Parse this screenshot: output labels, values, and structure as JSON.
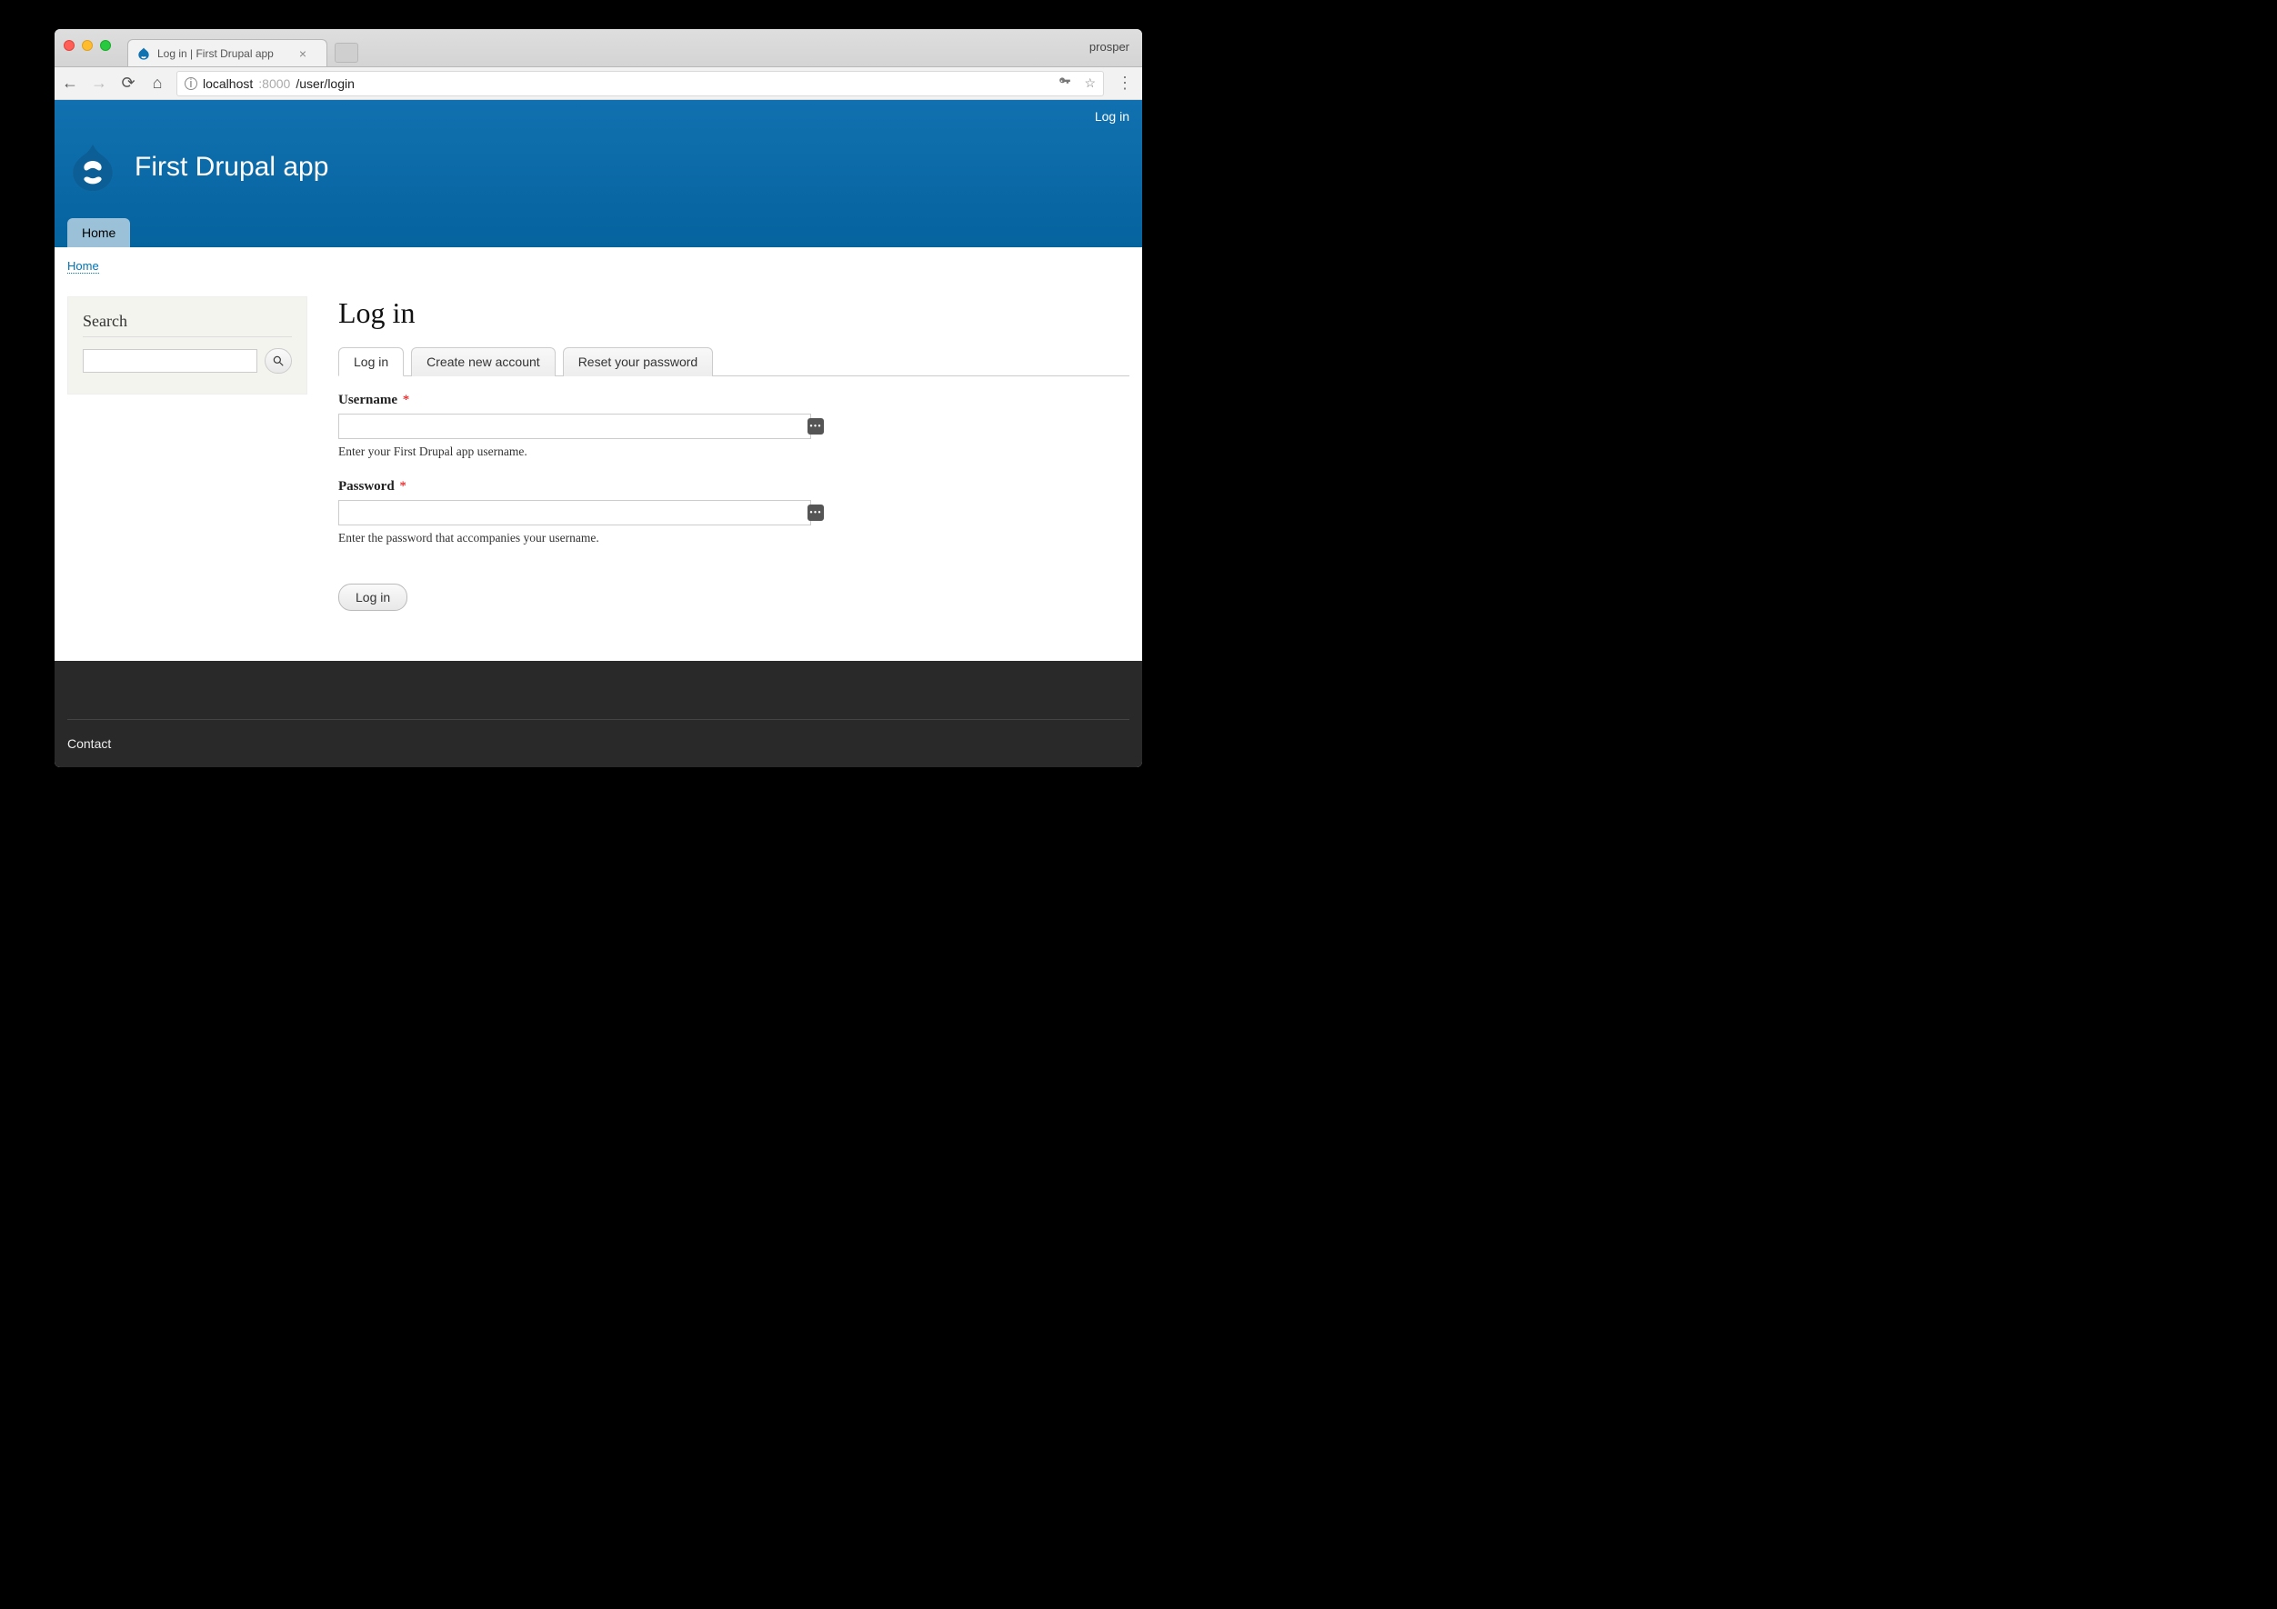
{
  "browser": {
    "tab_title": "Log in | First Drupal app",
    "profile": "prosper",
    "url_host": "localhost",
    "url_port": ":8000",
    "url_path": "/user/login"
  },
  "header": {
    "login_link": "Log in",
    "site_name": "First Drupal app",
    "nav": {
      "home": "Home"
    }
  },
  "breadcrumb": {
    "home": "Home"
  },
  "sidebar": {
    "search_heading": "Search"
  },
  "main": {
    "title": "Log in",
    "tabs": {
      "login": "Log in",
      "create": "Create new account",
      "reset": "Reset your password"
    },
    "form": {
      "username_label": "Username",
      "username_help": "Enter your First Drupal app username.",
      "password_label": "Password",
      "password_help": "Enter the password that accompanies your username.",
      "submit": "Log in"
    }
  },
  "footer": {
    "contact": "Contact"
  }
}
